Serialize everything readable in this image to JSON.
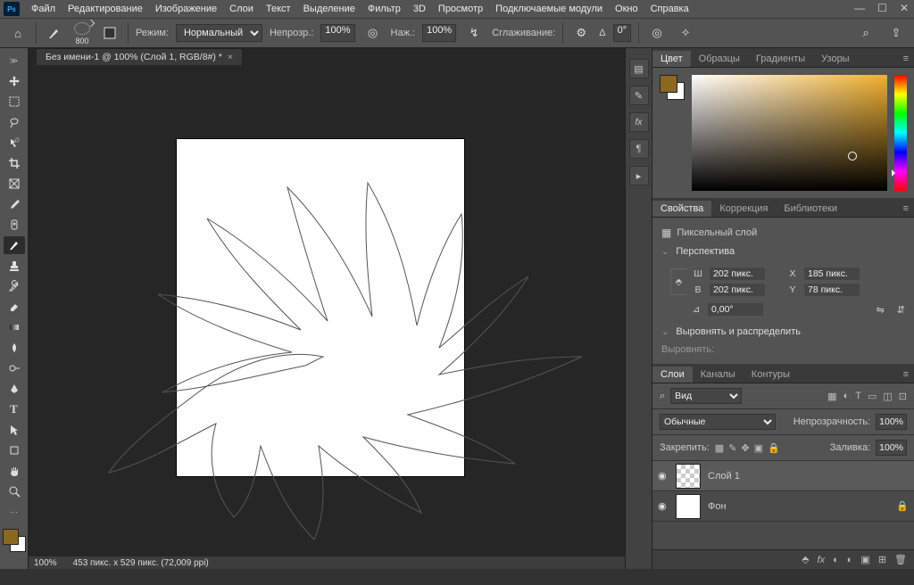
{
  "app": {
    "logo": "Ps"
  },
  "menu": [
    "Файл",
    "Редактирование",
    "Изображение",
    "Слои",
    "Текст",
    "Выделение",
    "Фильтр",
    "3D",
    "Просмотр",
    "Подключаемые модули",
    "Окно",
    "Справка"
  ],
  "window_buttons": {
    "min": "—",
    "max": "☐",
    "close": "✕"
  },
  "options": {
    "brush_size": "800",
    "mode_label": "Режим:",
    "mode_value": "Нормальный",
    "opacity_label": "Непрозр.:",
    "opacity_value": "100%",
    "flow_label": "Наж.:",
    "flow_value": "100%",
    "smoothing_label": "Сглаживание:",
    "angle_label": "Δ",
    "angle_value": "0°"
  },
  "document": {
    "tab_title": "Без имени-1 @ 100% (Слой 1, RGB/8#) *",
    "zoom": "100%",
    "dims": "453 пикс. x 529 пикс. (72,009 ppi)"
  },
  "panels": {
    "color": {
      "tabs": [
        "Цвет",
        "Образцы",
        "Градиенты",
        "Узоры"
      ],
      "active": 0
    },
    "props": {
      "tabs": [
        "Свойства",
        "Коррекция",
        "Библиотеки"
      ],
      "active": 0,
      "layer_type": "Пиксельный слой",
      "section_transform": "Перспектива",
      "w_label": "Ш",
      "w_value": "202 пикс.",
      "x_label": "X",
      "x_value": "185 пикс.",
      "h_label": "В",
      "h_value": "202 пикс.",
      "y_label": "Y",
      "y_value": "78 пикс.",
      "angle_value": "0,00°",
      "section_align": "Выровнять и распределить",
      "align_label": "Выровнять:"
    },
    "layers": {
      "tabs": [
        "Слои",
        "Каналы",
        "Контуры"
      ],
      "active": 0,
      "filter_label": "Вид",
      "blend_value": "Обычные",
      "opacity_label": "Непрозрачность:",
      "opacity_value": "100%",
      "lock_label": "Закрепить:",
      "fill_label": "Заливка:",
      "fill_value": "100%",
      "items": [
        {
          "name": "Слой 1",
          "selected": true,
          "checker": true,
          "locked": false
        },
        {
          "name": "Фон",
          "selected": false,
          "checker": false,
          "locked": true
        }
      ]
    }
  },
  "icons": {
    "search": "⌕",
    "share": "⇪",
    "home": "⌂",
    "gear": "⚙",
    "butterfly": "✧",
    "target": "◎",
    "pen": "✎",
    "eye": "◉",
    "lock": "🔒",
    "link": "⬘",
    "trash": "🗑",
    "new": "⊞",
    "folder": "▣",
    "mask": "◐",
    "fx": "fx",
    "flip_h": "⇋",
    "flip_v": "⇵"
  }
}
